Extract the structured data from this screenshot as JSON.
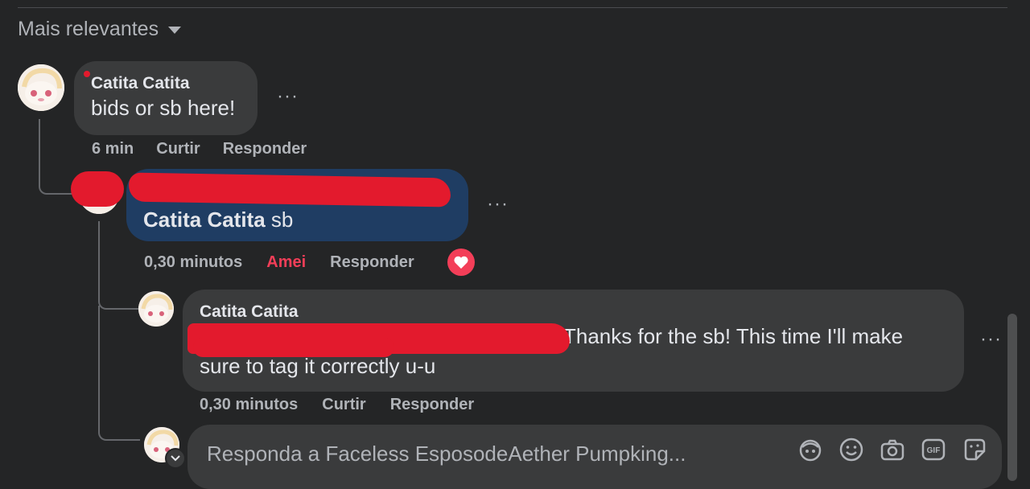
{
  "sort": {
    "label": "Mais relevantes"
  },
  "comments": [
    {
      "author": "Catita Catita",
      "text": "bids or sb here!",
      "time": "6 min",
      "like_label": "Curtir",
      "reply_label": "Responder"
    },
    {
      "mention": "Catita Catita",
      "text": " sb",
      "time": "0,30 minutos",
      "reaction_label": "Amei",
      "reply_label": "Responder",
      "reaction_icon": "heart-icon"
    },
    {
      "author": "Catita Catita",
      "text_line1": "Thanks for the sb! This time I'll make",
      "text_line2": "sure to tag it correctly u-u",
      "time": "0,30 minutos",
      "like_label": "Curtir",
      "reply_label": "Responder"
    }
  ],
  "more_label": "···",
  "reply_box": {
    "placeholder": "Responda a Faceless EsposodeAether Pumpking...",
    "icons": [
      "avatar-sticker-icon",
      "emoji-icon",
      "camera-icon",
      "gif-icon",
      "sticker-icon"
    ],
    "gif_label": "GIF"
  },
  "colors": {
    "background": "#242526",
    "bubble": "#3a3b3c",
    "highlight_bubble": "#1f3d63",
    "love_red": "#f33e58",
    "redaction": "#e31a2d"
  }
}
